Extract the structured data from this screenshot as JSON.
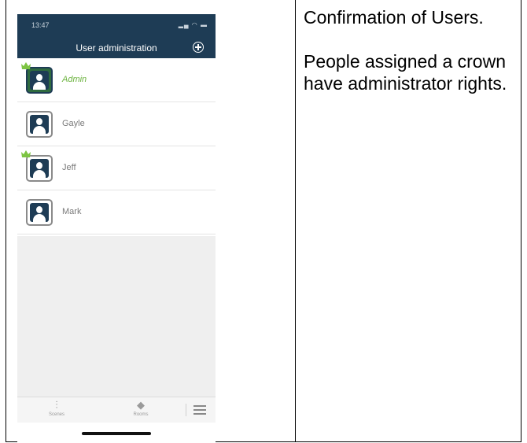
{
  "phone": {
    "status": {
      "time": "13:47"
    },
    "header": {
      "title": "User administration",
      "add_icon": "plus-circle-icon"
    },
    "users": [
      {
        "name": "Admin",
        "admin": true,
        "selected": true
      },
      {
        "name": "Gayle",
        "admin": false,
        "selected": false
      },
      {
        "name": "Jeff",
        "admin": true,
        "selected": false
      },
      {
        "name": "Mark",
        "admin": false,
        "selected": false
      }
    ],
    "tabbar": {
      "scenes": {
        "label": "Scenes",
        "icon": "sliders-icon"
      },
      "rooms": {
        "label": "Rooms",
        "icon": "layers-icon"
      },
      "menu": {
        "icon": "hamburger-menu-icon"
      }
    },
    "colors": {
      "header": "#1e3c55",
      "selected_text": "#6cb33f",
      "crown": "#7dc442"
    }
  },
  "caption": {
    "line1": "Confirmation of Users.",
    "line2": "People assigned a crown have administrator rights."
  }
}
